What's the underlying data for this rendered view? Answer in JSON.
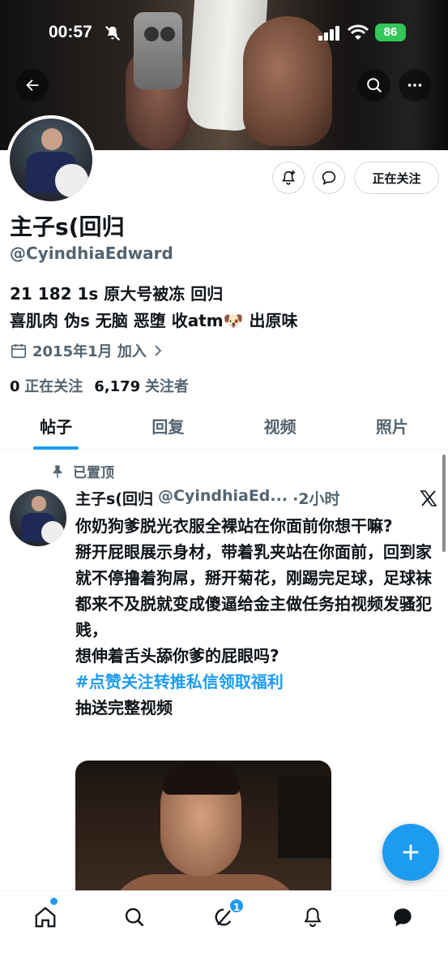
{
  "status_bar": {
    "time": "00:57",
    "battery": "86"
  },
  "profile": {
    "name": "主子s(回归",
    "handle": "@CyindhiaEdward",
    "bio_line1": "21 182 1s 原大号被冻 回归",
    "bio_line2": "喜肌肉 伪s 无脑 恶堕 收atm🐶 出原味",
    "joined": "2015年1月 加入",
    "following_count": "0",
    "following_label": "正在关注",
    "followers_count": "6,179",
    "followers_label": "关注者",
    "follow_button": "正在关注"
  },
  "tabs": [
    {
      "label": "帖子",
      "active": true
    },
    {
      "label": "回复",
      "active": false
    },
    {
      "label": "视频",
      "active": false
    },
    {
      "label": "照片",
      "active": false
    }
  ],
  "post": {
    "pinned_label": "已置顶",
    "author_name": "主子s(回归",
    "author_handle": "@CyindhiaEd...",
    "time": "·2小时",
    "lines": [
      "你奶狗爹脱光衣服全裸站在你面前你想干嘛?",
      "掰开屁眼展示身材，带着乳夹站在你面前，回到家就不停撸着狗屌，掰开菊花，刚踢完足球，足球袜都来不及脱就变成傻逼给金主做任务拍视频发骚犯贱，",
      "想伸着舌头舔你爹的屁眼吗?"
    ],
    "hashtag": "#点赞关注转推私信领取福利",
    "last_line": "抽送完整视频"
  },
  "bottom_nav": {
    "items": [
      "home-icon",
      "search-icon",
      "spaces-icon",
      "notifications-icon",
      "messages-icon"
    ],
    "spaces_badge": "1"
  },
  "colors": {
    "accent": "#1d9bf0",
    "text": "#0f1419",
    "secondary": "#536471"
  }
}
